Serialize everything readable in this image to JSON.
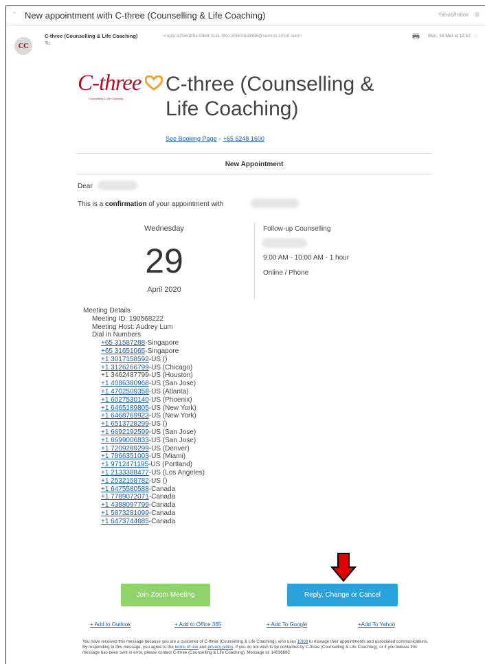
{
  "email": {
    "subject": "New appointment with C-three (Counselling & Life Coaching)",
    "folder": "Yahoo/Inbox",
    "avatar_initials": "CC",
    "sender_name": "C-three (Counselling & Life Coaching)",
    "sender_email": "<reply-a3f26189a-9db9-4c11-9fcc-3f4504c38f96@comms.10to8.com>",
    "to_label": "To:",
    "date": "Mon, 30 Mar at 12:52"
  },
  "logo": {
    "wordmark": "C-three",
    "tagline": "Counselling & Life Coaching",
    "brand_color": "#b0122b",
    "heart_color": "#f2a030"
  },
  "company_name": "C-three (Counselling & Life Coaching)",
  "links": {
    "booking_page": "See Booking Page",
    "separator": "-",
    "phone": "+65 6248 1600"
  },
  "section_title": "New Appointment",
  "greeting": {
    "dear": "Dear",
    "confirm_prefix": "This is a",
    "confirm_bold": "confirmation",
    "confirm_suffix": "of your appointment with"
  },
  "appointment": {
    "weekday": "Wednesday",
    "day": "29",
    "month_year": "April 2020",
    "service": "Follow-up Counselling",
    "time": "9:00 AM - 10:00 AM - 1 hour",
    "mode": "Online / Phone"
  },
  "meeting": {
    "heading": "Meeting Details",
    "meeting_id": "Meeting ID: 190568222",
    "host": "Meeting Host: Audrey Lum",
    "dial_in_heading": "Dial in Numbers",
    "numbers": [
      {
        "number": "+65 31587288",
        "place": "-Singapore",
        "linked": true
      },
      {
        "number": "+65 31651065",
        "place": "-Singapore",
        "linked": true
      },
      {
        "number": "+1 3017158592",
        "place": "-US ()",
        "linked": true
      },
      {
        "number": "+1 3126266799",
        "place": "-US (Chicago)",
        "linked": true
      },
      {
        "number": "+1 3462487799",
        "place": "-US (Houston)",
        "linked": false
      },
      {
        "number": "+1 4086380968",
        "place": "-US (San Jose)",
        "linked": true
      },
      {
        "number": "+1 4702509358",
        "place": "-US (Atlanta)",
        "linked": true
      },
      {
        "number": "+1 6027530140",
        "place": "-US (Phoenix)",
        "linked": true
      },
      {
        "number": "+1 6465189805",
        "place": "-US (New York)",
        "linked": true
      },
      {
        "number": "+1 6468769923",
        "place": "-US (New York)",
        "linked": true
      },
      {
        "number": "+1 6513728299",
        "place": "-US ()",
        "linked": true
      },
      {
        "number": "+1 6692192599",
        "place": "-US (San Jose)",
        "linked": true
      },
      {
        "number": "+1 6699006833",
        "place": "-US (San Jose)",
        "linked": true
      },
      {
        "number": "+1 7209289299",
        "place": "-US (Denver)",
        "linked": true
      },
      {
        "number": "+1 7866351003",
        "place": "-US (Miami)",
        "linked": true
      },
      {
        "number": "+1 9712471195",
        "place": "-US (Portland)",
        "linked": true
      },
      {
        "number": "+1 2133388477",
        "place": "-US (Los Angeles)",
        "linked": true
      },
      {
        "number": "+1 2532158782",
        "place": "-US ()",
        "linked": true
      },
      {
        "number": "+1 6475580588",
        "place": "-Canada",
        "linked": true
      },
      {
        "number": "+1 7789072071",
        "place": "-Canada",
        "linked": true
      },
      {
        "number": "+1 4388097799",
        "place": "-Canada",
        "linked": true
      },
      {
        "number": "+1 5873281099",
        "place": "-Canada",
        "linked": true
      },
      {
        "number": "+1 6473744685",
        "place": "-Canada",
        "linked": true
      }
    ]
  },
  "buttons": {
    "zoom": "Join Zoom Meeting",
    "reply": "Reply, Change or Cancel",
    "zoom_color": "#8fd36a",
    "reply_color": "#2aa2dc",
    "arrow_color": "#e00000"
  },
  "calendar_links": {
    "outlook": "+ Add to Outlook",
    "office365": "+ Add to Office 365",
    "google": "+ Add To Google",
    "yahoo": "+Add To Yahoo"
  },
  "footer": {
    "part1": "You have received this message because you are a customer of C-three (Counselling & Life Coaching), who uses",
    "link_10to8": "10to8",
    "part2": "to manage their appointments and associated communications. By responding to this message, you agree to the",
    "link_terms": "terms of use",
    "part3": "and",
    "link_privacy": "privacy policy",
    "part4": ". If you do not wish to be contacted by C-three (Counselling & Life Coaching), or if you believe this message has been sent in error, please contact C-three (Counselling & Life Coaching). Message id: 14036682"
  }
}
